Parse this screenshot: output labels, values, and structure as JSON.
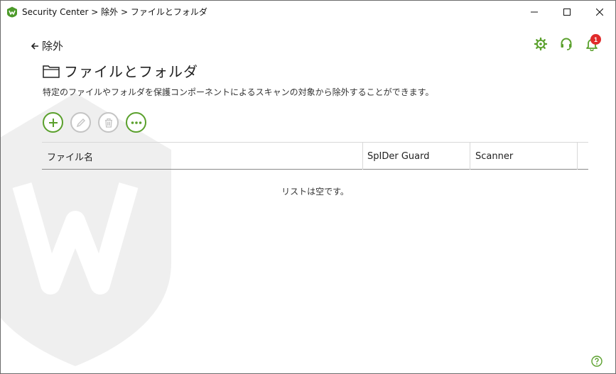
{
  "window": {
    "title": "Security Center > 除外 > ファイルとフォルダ"
  },
  "header": {
    "back_label": "除外",
    "notification_count": "1"
  },
  "page": {
    "title": "ファイルとフォルダ",
    "description": "特定のファイルやフォルダを保護コンポーネントによるスキャンの対象から除外することができます。"
  },
  "table": {
    "columns": [
      "ファイル名",
      "SpIDer Guard",
      "Scanner"
    ],
    "empty_message": "リストは空です。",
    "rows": []
  },
  "colors": {
    "accent": "#5aa02c",
    "disabled": "#c4c4c4",
    "badge": "#e02a2a"
  },
  "icons": {
    "app": "dr-web-logo-icon",
    "back": "arrow-left-icon",
    "folder": "folder-icon",
    "add": "plus-icon",
    "edit": "pencil-icon",
    "delete": "trash-icon",
    "more": "more-dots-icon",
    "settings": "gear-icon",
    "support": "headset-icon",
    "notifications": "bell-icon",
    "help": "help-icon"
  }
}
